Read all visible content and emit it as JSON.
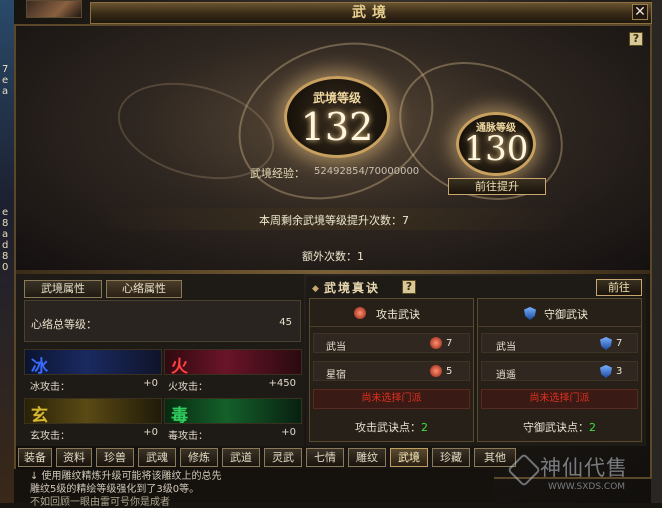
{
  "window": {
    "title": "武境"
  },
  "hero": {
    "realm_level_label": "武境等级",
    "realm_level": "132",
    "meridian_level_label": "通脉等级",
    "meridian_level": "130",
    "exp_label": "武境经验：",
    "exp_value": "52492854/70000000",
    "upgrade_button": "前往提升",
    "weekly_remaining": "本周剩余武境等级提升次数：7",
    "extra_times": "额外次数：1"
  },
  "left_panel": {
    "tabs": [
      "武境属性",
      "心络属性"
    ],
    "meridian_total_label": "心络总等级：",
    "meridian_total_value": "45",
    "elements": [
      {
        "char": "冰",
        "label": "冰攻击：",
        "value": "+0",
        "color": "#3a6aff"
      },
      {
        "char": "火",
        "label": "火攻击：",
        "value": "+450",
        "color": "#ff4040"
      },
      {
        "char": "玄",
        "label": "玄攻击：",
        "value": "+0",
        "color": "#d8b830"
      },
      {
        "char": "毒",
        "label": "毒攻击：",
        "value": "+0",
        "color": "#30d060"
      }
    ]
  },
  "skills": {
    "title": "武境真诀",
    "go_button": "前往",
    "attack": {
      "header": "攻击武诀",
      "rows": [
        {
          "name": "武当",
          "value": "7"
        },
        {
          "name": "星宿",
          "value": "5"
        }
      ],
      "no_sect": "尚未选择门派",
      "points_label": "攻击武诀点：",
      "points_value": "2"
    },
    "defense": {
      "header": "守御武诀",
      "rows": [
        {
          "name": "武当",
          "value": "7"
        },
        {
          "name": "逍遥",
          "value": "3"
        }
      ],
      "no_sect": "尚未选择门派",
      "points_label": "守御武诀点：",
      "points_value": "2"
    }
  },
  "bottom_tabs": [
    "装备",
    "资料",
    "珍兽",
    "武魂",
    "修炼",
    "武道",
    "灵武",
    "七情",
    "雕纹",
    "武境",
    "珍藏",
    "其他"
  ],
  "bottom_tabs_active_index": 9,
  "chat": {
    "line1": "↓ 使用雕纹精炼升级可能将该雕纹上的总先",
    "line2": "雕纹5级的精绘等级强化到了3级0等。",
    "line3": "不如回顾一眼由雷可号你是成者"
  },
  "watermark": {
    "brand": "神仙代售",
    "url": "WWW.SXDS.COM"
  },
  "left_strip_chars": [
    "7",
    "e",
    "a",
    "e",
    "8",
    "a",
    "d",
    "8",
    "0"
  ]
}
